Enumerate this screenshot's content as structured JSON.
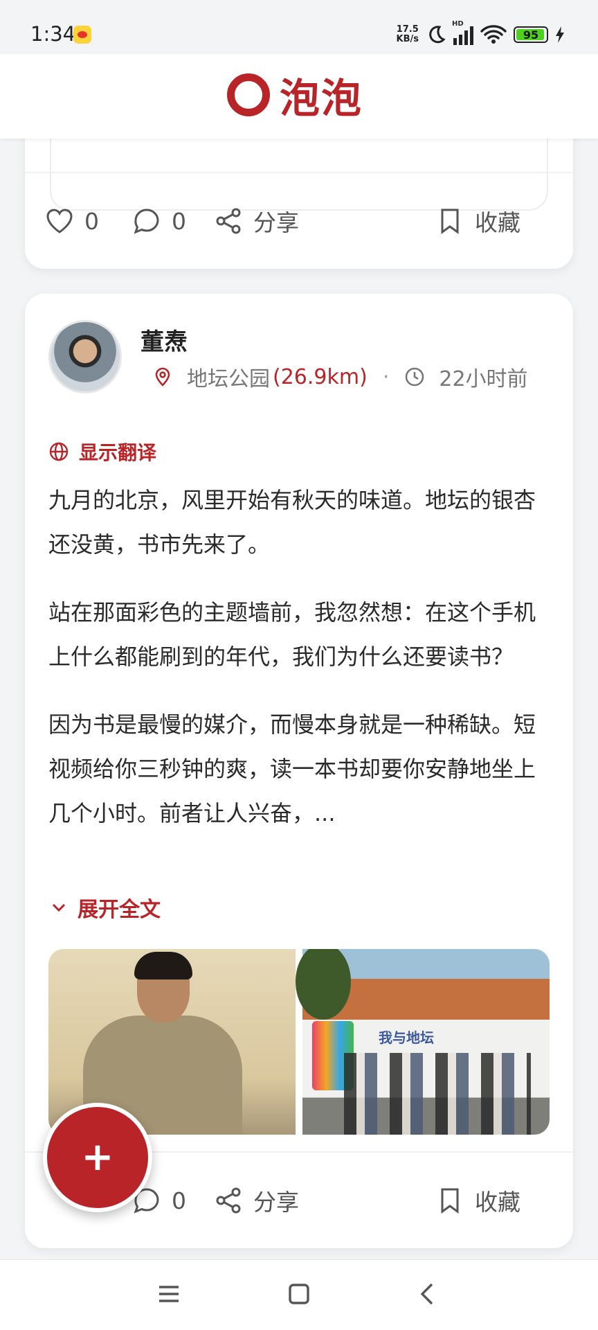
{
  "status_bar": {
    "time": "1:34",
    "net_speed_value": "17.5",
    "net_speed_unit": "KB/s",
    "signal_label": "HD",
    "battery_percent": "95",
    "battery_level": 0.95,
    "icons": [
      "weibo-icon",
      "moon-icon",
      "signal-icon",
      "wifi-icon",
      "battery-icon",
      "charging-icon"
    ]
  },
  "header": {
    "logo_text": "泡泡",
    "brand_color": "#b82428"
  },
  "top_card": {
    "like_count": "0",
    "comment_count": "0",
    "share_label": "分享",
    "bookmark_label": "收藏"
  },
  "post": {
    "author": "董焘",
    "location": "地坛公园",
    "distance": "(26.9km)",
    "separator": "·",
    "time_ago": "22小时前",
    "translate_label": "显示翻译",
    "paragraphs": [
      "九月的北京，风里开始有秋天的味道。地坛的银杏还没黄，书市先来了。",
      "站在那面彩色的主题墙前，我忽然想：在这个手机上什么都能刷到的年代，我们为什么还要读书？",
      "因为书是最慢的媒介，而慢本身就是一种稀缺。短视频给你三秒钟的爽，读一本书却要你安静地坐上几个小时。前者让人兴奋，..."
    ],
    "expand_label": "展开全文",
    "image_banner_text": "我与地坛",
    "comment_count": "0",
    "share_label": "分享",
    "bookmark_label": "收藏"
  },
  "fab": {
    "label": "+"
  },
  "nav": {
    "icons": [
      "menu-icon",
      "home-icon",
      "back-icon"
    ]
  }
}
